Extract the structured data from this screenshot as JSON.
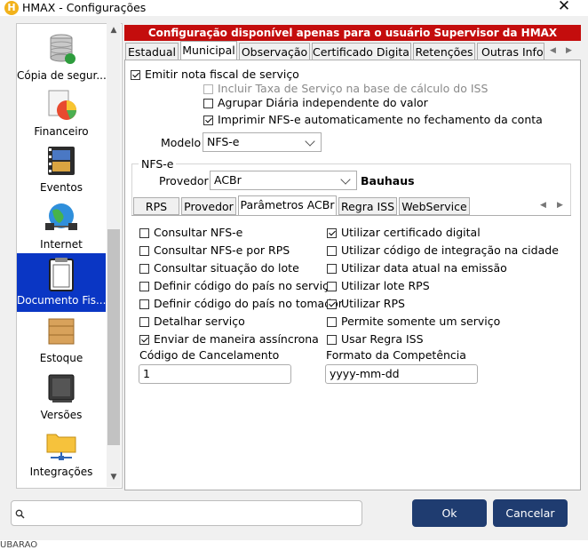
{
  "window": {
    "title": "HMAX - Configurações",
    "app_icon_letter": "H",
    "close": "✕"
  },
  "sidebar": {
    "items": [
      {
        "label": "Cópia de segur...",
        "icon": "database-icon"
      },
      {
        "label": "Financeiro",
        "icon": "chart-pie-icon"
      },
      {
        "label": "Eventos",
        "icon": "film-icon"
      },
      {
        "label": "Internet",
        "icon": "globe-network-icon"
      },
      {
        "label": "Documento Fis...",
        "icon": "clipboard-icon",
        "selected": true
      },
      {
        "label": "Estoque",
        "icon": "box-icon"
      },
      {
        "label": "Versões",
        "icon": "chip-icon"
      },
      {
        "label": "Integrações",
        "icon": "folder-network-icon"
      }
    ]
  },
  "warning": "Configuração disponível apenas para o usuário Supervisor da HMAX",
  "tabs": [
    "Estadual",
    "Municipal",
    "Observação",
    "Certificado Digital",
    "Retenções",
    "Outras Infor"
  ],
  "active_tab": "Municipal",
  "municipal": {
    "emitir": {
      "label": "Emitir nota fiscal de serviço",
      "checked": true
    },
    "incluir_taxa": {
      "label": "Incluir Taxa de Serviço na base de cálculo do ISS",
      "checked": false,
      "disabled": true
    },
    "agrupar": {
      "label": "Agrupar Diária independente do valor",
      "checked": false
    },
    "imprimir": {
      "label": "Imprimir NFS-e automaticamente no fechamento da conta",
      "checked": true
    },
    "modelo_label": "Modelo",
    "modelo_value": "NFS-e",
    "group_title": "NFS-e",
    "provedor_label": "Provedor",
    "provedor_value": "ACBr",
    "city": "Bauhaus",
    "inner_tabs": [
      "RPS",
      "Provedor",
      "Parâmetros ACBr",
      "Regra ISS",
      "WebService"
    ],
    "inner_active": "Parâmetros ACBr",
    "left_checks": [
      {
        "label": "Consultar NFS-e",
        "checked": false
      },
      {
        "label": "Consultar NFS-e por RPS",
        "checked": false
      },
      {
        "label": "Consultar situação do lote",
        "checked": false
      },
      {
        "label": "Definir código do país no serviço",
        "checked": false
      },
      {
        "label": "Definir código do país no tomador",
        "checked": false
      },
      {
        "label": "Detalhar serviço",
        "checked": false
      },
      {
        "label": "Enviar de maneira assíncrona",
        "checked": true
      }
    ],
    "right_checks": [
      {
        "label": "Utilizar certificado digital",
        "checked": true
      },
      {
        "label": "Utilizar código de integração na cidade",
        "checked": false
      },
      {
        "label": "Utilizar data atual na emissão",
        "checked": false
      },
      {
        "label": "Utilizar lote RPS",
        "checked": false
      },
      {
        "label": "Utilizar RPS",
        "checked": true
      },
      {
        "label": "Permite somente um serviço",
        "checked": false
      },
      {
        "label": "Usar Regra ISS",
        "checked": false
      }
    ],
    "codigo_cancelamento_label": "Código de Cancelamento",
    "codigo_cancelamento_value": "1",
    "formato_competencia_label": "Formato da Competência",
    "formato_competencia_value": "yyyy-mm-dd"
  },
  "bottom": {
    "search_placeholder": "",
    "ok": "Ok",
    "cancel": "Cancelar"
  },
  "footer_text": "UBARAO",
  "colors": {
    "warning_bg": "#c40d0d",
    "selected_bg": "#0a36c4",
    "button_bg": "#1f3c70"
  }
}
